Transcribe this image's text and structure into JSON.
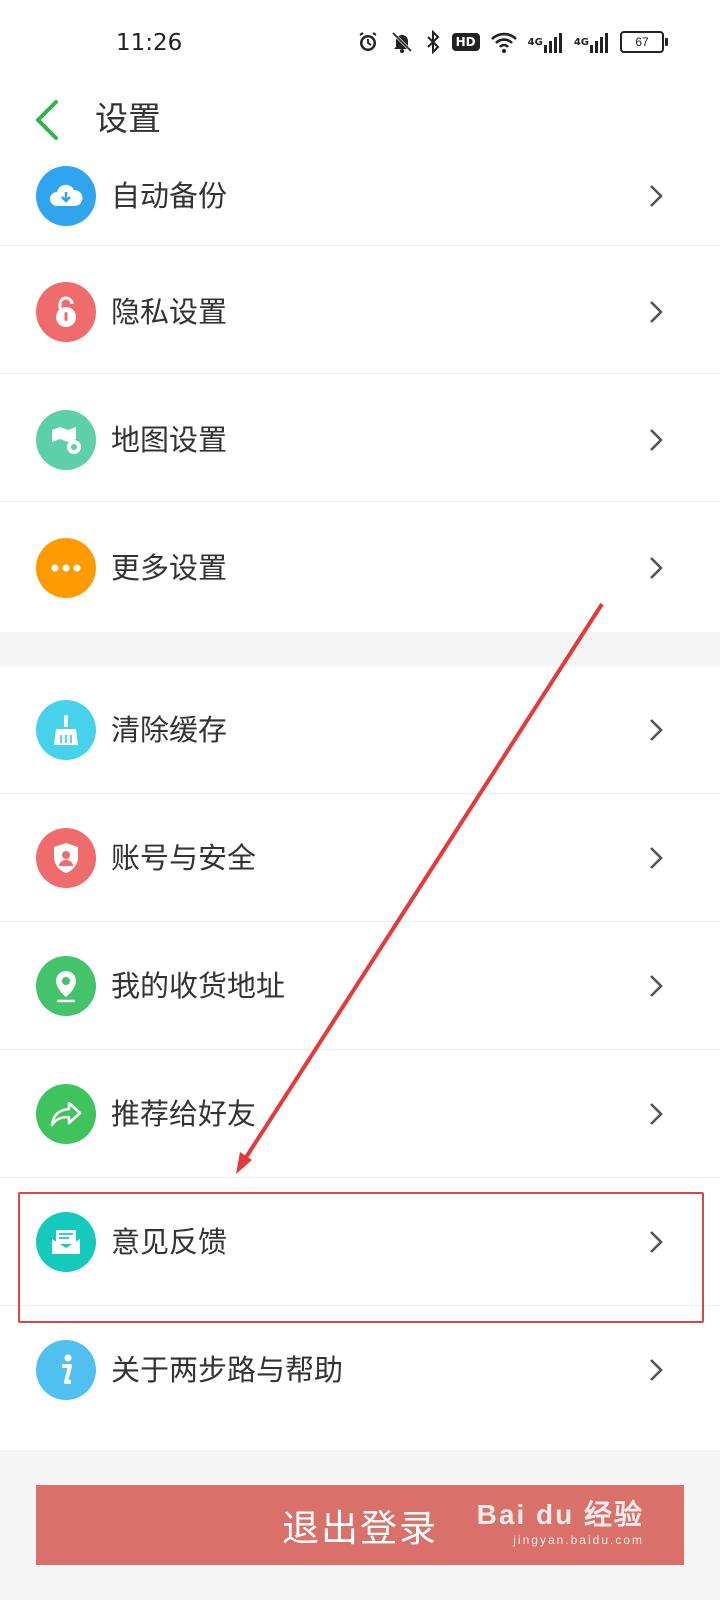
{
  "status_bar": {
    "time": "11:26",
    "hd_label": "HD",
    "net1": "4G",
    "net2": "4G",
    "battery": "67",
    "icons": [
      "alarm-icon",
      "bell-off-icon",
      "bluetooth-icon",
      "hd-icon",
      "wifi-icon",
      "signal-4g-icon",
      "signal-4g-icon",
      "battery-icon"
    ]
  },
  "header": {
    "title": "设置",
    "back_icon": "back-arrow-icon",
    "accent_color": "#2fb54a"
  },
  "settings_group_1": [
    {
      "label": "自动备份",
      "icon": "cloud-download-icon",
      "color": "#2fa4ef"
    },
    {
      "label": "隐私设置",
      "icon": "lock-icon",
      "color": "#f06b6b"
    },
    {
      "label": "地图设置",
      "icon": "map-settings-icon",
      "color": "#5dcfa9"
    },
    {
      "label": "更多设置",
      "icon": "more-dots-icon",
      "color": "#ff9a00"
    }
  ],
  "settings_group_2": [
    {
      "label": "清除缓存",
      "icon": "broom-icon",
      "color": "#45d2ea"
    },
    {
      "label": "账号与安全",
      "icon": "shield-user-icon",
      "color": "#f06b6b"
    },
    {
      "label": "我的收货地址",
      "icon": "location-pin-icon",
      "color": "#43c46a"
    },
    {
      "label": "推荐给好友",
      "icon": "share-arrow-icon",
      "color": "#3fc35b"
    },
    {
      "label": "意见反馈",
      "icon": "envelope-icon",
      "color": "#16c9bd"
    },
    {
      "label": "关于两步路与帮助",
      "icon": "info-icon",
      "color": "#4fc0ef"
    }
  ],
  "logout_button": {
    "label": "退出登录",
    "color": "#d9716a"
  },
  "annotation": {
    "highlight_color": "#d94848",
    "highlighted_item": "意见反馈"
  },
  "watermark": {
    "main": "Bai du 经验",
    "sub": "jingyan.baidu.com"
  }
}
